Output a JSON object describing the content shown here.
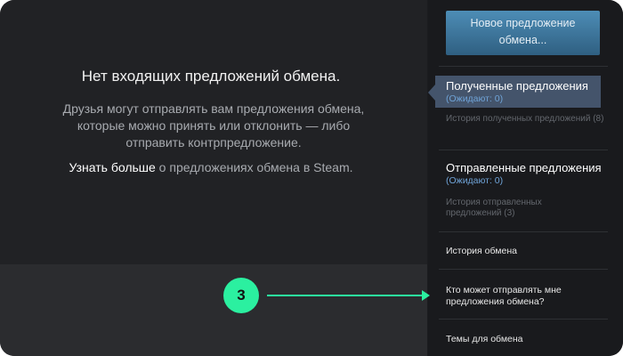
{
  "main": {
    "empty_title": "Нет входящих предложений обмена.",
    "empty_description": "Друзья могут отправлять вам предложения обмена, которые можно принять или отклонить — либо отправить контрпредложение.",
    "learn_more_link": "Узнать больше",
    "learn_more_rest": " о предложениях обмена в Steam."
  },
  "sidebar": {
    "new_offer_line1": "Новое предложение",
    "new_offer_line2": "обмена...",
    "received": {
      "title": "Полученные предложения",
      "pending": "(Ожидают: 0)",
      "history": "История полученных предложений (8)"
    },
    "sent": {
      "title": "Отправленные предложения",
      "pending": "(Ожидают: 0)",
      "history": "История отправленных предложений (3)"
    },
    "trade_history": "История обмена",
    "who_can_send": "Кто может отправлять мне предложения обмена?",
    "trade_topics": "Темы для обмена"
  },
  "annotation": {
    "step_number": "3"
  },
  "colors": {
    "accent": "#2bf0a0",
    "button_top": "#4d8db6",
    "active_item": "#44546b",
    "pending_text": "#6fa3d7"
  }
}
